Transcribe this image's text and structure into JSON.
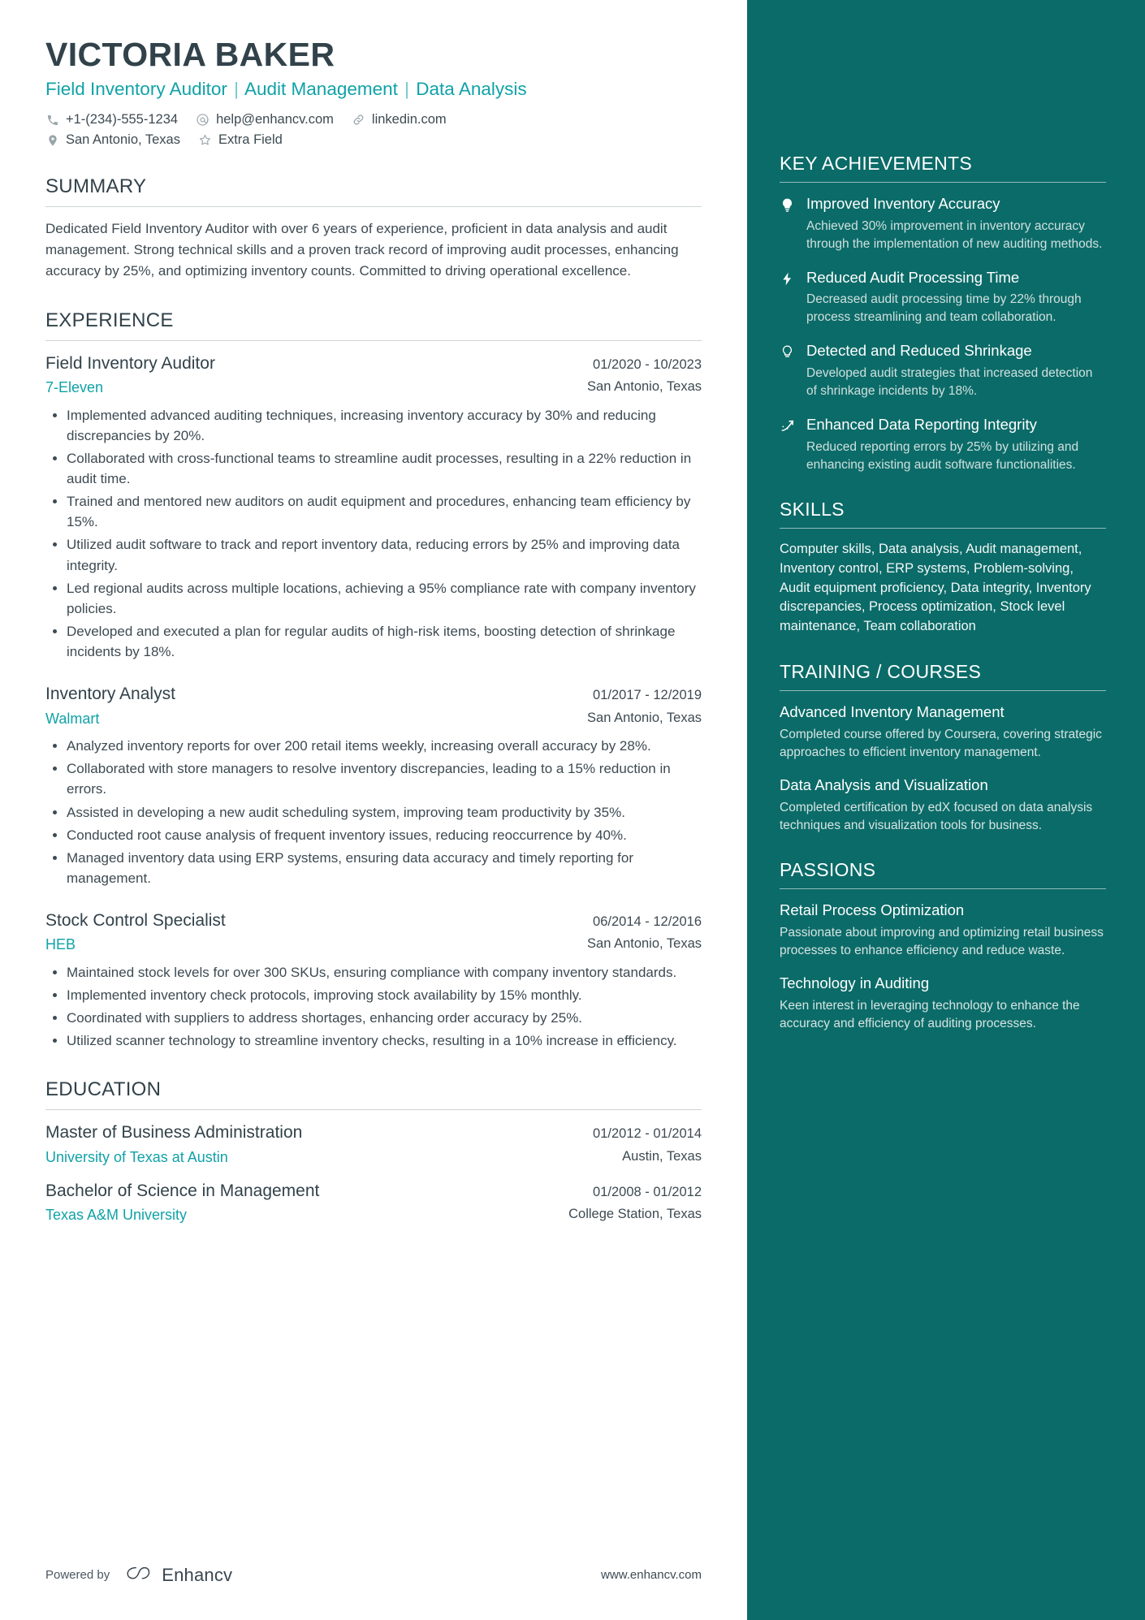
{
  "header": {
    "name": "VICTORIA BAKER",
    "headline_parts": [
      "Field Inventory Auditor",
      "Audit Management",
      "Data Analysis"
    ],
    "separator": "|",
    "accent_color": "#10a2a8",
    "contacts_row1": [
      {
        "icon": "phone-icon",
        "text": "+1-(234)-555-1234"
      },
      {
        "icon": "email-icon",
        "text": "help@enhancv.com"
      },
      {
        "icon": "link-icon",
        "text": "linkedin.com"
      }
    ],
    "contacts_row2": [
      {
        "icon": "location-icon",
        "text": "San Antonio, Texas"
      },
      {
        "icon": "star-icon",
        "text": "Extra Field"
      }
    ]
  },
  "summary": {
    "heading": "SUMMARY",
    "text": "Dedicated Field Inventory Auditor with over 6 years of experience, proficient in data analysis and audit management. Strong technical skills and a proven track record of improving audit processes, enhancing accuracy by 25%, and optimizing inventory counts. Committed to driving operational excellence."
  },
  "experience": {
    "heading": "EXPERIENCE",
    "items": [
      {
        "title": "Field Inventory Auditor",
        "date": "01/2020 - 10/2023",
        "organization": "7-Eleven",
        "location": "San Antonio, Texas",
        "bullets": [
          "Implemented advanced auditing techniques, increasing inventory accuracy by 30% and reducing discrepancies by 20%.",
          "Collaborated with cross-functional teams to streamline audit processes, resulting in a 22% reduction in audit time.",
          "Trained and mentored new auditors on audit equipment and procedures, enhancing team efficiency by 15%.",
          "Utilized audit software to track and report inventory data, reducing errors by 25% and improving data integrity.",
          "Led regional audits across multiple locations, achieving a 95% compliance rate with company inventory policies.",
          "Developed and executed a plan for regular audits of high-risk items, boosting detection of shrinkage incidents by 18%."
        ]
      },
      {
        "title": "Inventory Analyst",
        "date": "01/2017 - 12/2019",
        "organization": "Walmart",
        "location": "San Antonio, Texas",
        "bullets": [
          "Analyzed inventory reports for over 200 retail items weekly, increasing overall accuracy by 28%.",
          "Collaborated with store managers to resolve inventory discrepancies, leading to a 15% reduction in errors.",
          "Assisted in developing a new audit scheduling system, improving team productivity by 35%.",
          "Conducted root cause analysis of frequent inventory issues, reducing reoccurrence by 40%.",
          "Managed inventory data using ERP systems, ensuring data accuracy and timely reporting for management."
        ]
      },
      {
        "title": "Stock Control Specialist",
        "date": "06/2014 - 12/2016",
        "organization": "HEB",
        "location": "San Antonio, Texas",
        "bullets": [
          "Maintained stock levels for over 300 SKUs, ensuring compliance with company inventory standards.",
          "Implemented inventory check protocols, improving stock availability by 15% monthly.",
          "Coordinated with suppliers to address shortages, enhancing order accuracy by 25%.",
          "Utilized scanner technology to streamline inventory checks, resulting in a 10% increase in efficiency."
        ]
      }
    ]
  },
  "education": {
    "heading": "EDUCATION",
    "items": [
      {
        "degree": "Master of Business Administration",
        "date": "01/2012 - 01/2014",
        "school": "University of Texas at Austin",
        "location": "Austin, Texas"
      },
      {
        "degree": "Bachelor of Science in Management",
        "date": "01/2008 - 01/2012",
        "school": "Texas A&M University",
        "location": "College Station, Texas"
      }
    ]
  },
  "footer": {
    "powered_by": "Powered by",
    "brand": "Enhancv",
    "website": "www.enhancv.com"
  },
  "sidebar": {
    "background_color": "#0b6b68",
    "key_achievements": {
      "heading": "KEY ACHIEVEMENTS",
      "items": [
        {
          "icon": "lightbulb-icon",
          "title": "Improved Inventory Accuracy",
          "description": "Achieved 30% improvement in inventory accuracy through the implementation of new auditing methods."
        },
        {
          "icon": "lightning-bolt-icon",
          "title": "Reduced Audit Processing Time",
          "description": "Decreased audit processing time by 22% through process streamlining and team collaboration."
        },
        {
          "icon": "bulb-outline-icon",
          "title": "Detected and Reduced Shrinkage",
          "description": "Developed audit strategies that increased detection of shrinkage incidents by 18%."
        },
        {
          "icon": "trending-up-icon",
          "title": "Enhanced Data Reporting Integrity",
          "description": "Reduced reporting errors by 25% by utilizing and enhancing existing audit software functionalities."
        }
      ]
    },
    "skills": {
      "heading": "SKILLS",
      "text": "Computer skills, Data analysis, Audit management, Inventory control, ERP systems, Problem-solving, Audit equipment proficiency, Data integrity, Inventory discrepancies, Process optimization, Stock level maintenance, Team collaboration"
    },
    "training": {
      "heading": "TRAINING / COURSES",
      "items": [
        {
          "title": "Advanced Inventory Management",
          "description": "Completed course offered by Coursera, covering strategic approaches to efficient inventory management."
        },
        {
          "title": "Data Analysis and Visualization",
          "description": "Completed certification by edX focused on data analysis techniques and visualization tools for business."
        }
      ]
    },
    "passions": {
      "heading": "PASSIONS",
      "items": [
        {
          "title": "Retail Process Optimization",
          "description": "Passionate about improving and optimizing retail business processes to enhance efficiency and reduce waste."
        },
        {
          "title": "Technology in Auditing",
          "description": "Keen interest in leveraging technology to enhance the accuracy and efficiency of auditing processes."
        }
      ]
    }
  }
}
